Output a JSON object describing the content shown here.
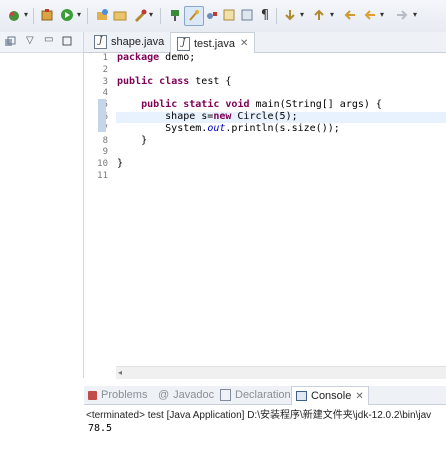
{
  "editor": {
    "tabs": [
      {
        "label": "shape.java",
        "active": false
      },
      {
        "label": "test.java",
        "active": true
      }
    ],
    "line_numbers": [
      "1",
      "2",
      "3",
      "4",
      "5",
      "6",
      "7",
      "8",
      "9",
      "10",
      "11"
    ],
    "lines": [
      {
        "segments": [
          {
            "t": "package",
            "c": "kw"
          },
          {
            "t": " demo;"
          }
        ]
      },
      {
        "segments": []
      },
      {
        "segments": [
          {
            "t": "public",
            "c": "kw"
          },
          {
            "t": " "
          },
          {
            "t": "class",
            "c": "kw"
          },
          {
            "t": " test {"
          }
        ]
      },
      {
        "segments": []
      },
      {
        "segments": [
          {
            "t": "    "
          },
          {
            "t": "public",
            "c": "kw"
          },
          {
            "t": " "
          },
          {
            "t": "static",
            "c": "kw"
          },
          {
            "t": " "
          },
          {
            "t": "void",
            "c": "kw"
          },
          {
            "t": " main(String[] args) {"
          }
        ]
      },
      {
        "segments": [
          {
            "t": "        shape s="
          },
          {
            "t": "new",
            "c": "kw"
          },
          {
            "t": " Circle(5);"
          }
        ]
      },
      {
        "segments": [
          {
            "t": "        System."
          },
          {
            "t": "out",
            "c": "it"
          },
          {
            "t": ".println(s.size());"
          }
        ]
      },
      {
        "segments": [
          {
            "t": "    }"
          }
        ]
      },
      {
        "segments": []
      },
      {
        "segments": [
          {
            "t": "}"
          }
        ]
      },
      {
        "segments": []
      }
    ],
    "current_line": 6
  },
  "bottom": {
    "tabs": [
      {
        "label": "Problems",
        "active": false
      },
      {
        "label": "Javadoc",
        "active": false
      },
      {
        "label": "Declaration",
        "active": false
      },
      {
        "label": "Console",
        "active": true
      }
    ],
    "status": "<terminated> test [Java Application] D:\\安装程序\\新建文件夹\\jdk-12.0.2\\bin\\jav",
    "output": "78.5"
  },
  "colors": {
    "keyword": "#7f0055",
    "static_field": "#0000c0",
    "current_line": "#e8f2fe"
  }
}
